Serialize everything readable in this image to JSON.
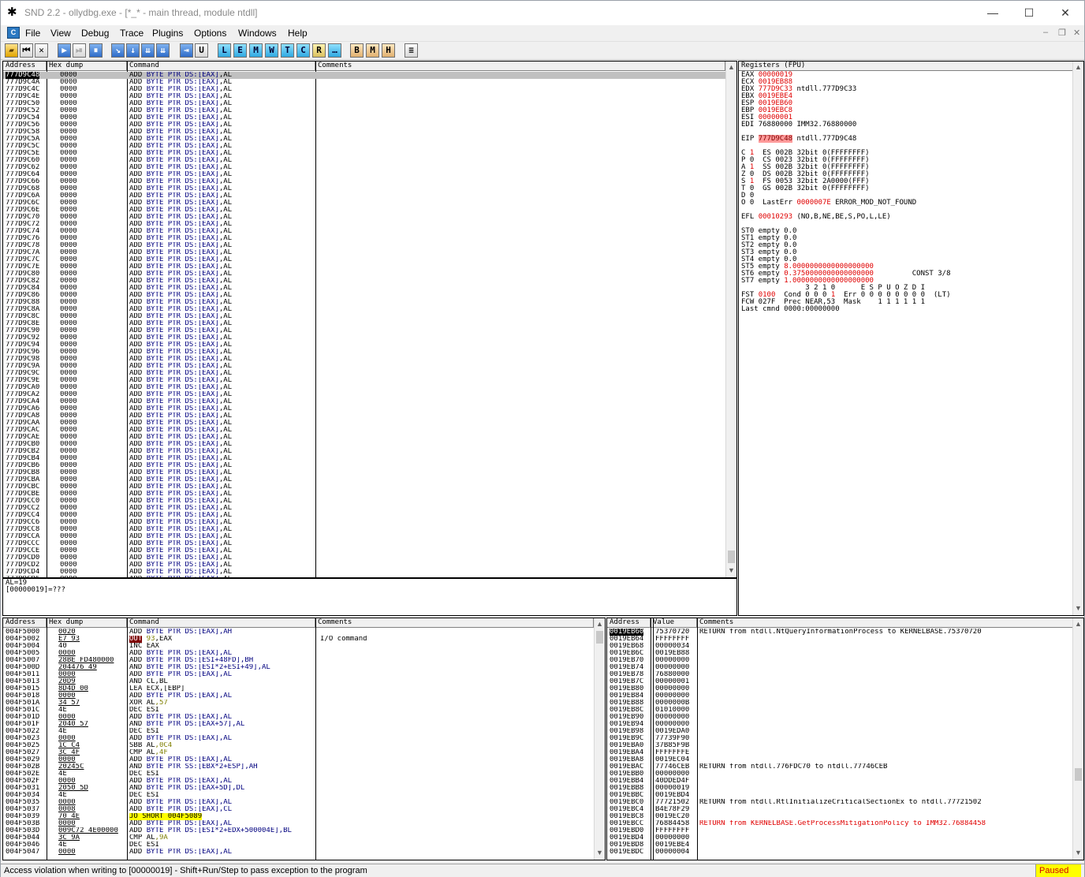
{
  "window": {
    "title": "SND 2.2 - ollydbg.exe - [*_* - main thread, module ntdll]",
    "minimize": "—",
    "maximize": "☐",
    "close": "✕"
  },
  "menu": {
    "mdi_icon": "C",
    "items": [
      "File",
      "View",
      "Debug",
      "Trace",
      "Plugins",
      "Options",
      "Windows",
      "Help"
    ],
    "mdi_min": "‒",
    "mdi_restore": "❐",
    "mdi_close": "✕"
  },
  "toolbar": {
    "buttons": [
      "open",
      "⏮",
      "✕",
      "▶",
      "⏸",
      "⏯",
      "↘",
      "↓",
      "⇊",
      "⇥",
      "U",
      "L",
      "E",
      "M",
      "W",
      "T",
      "C",
      "R",
      "…",
      "B",
      "M",
      "H",
      "≡"
    ]
  },
  "cpu": {
    "headers": {
      "address": "Address",
      "hex": "Hex dump",
      "command": "Command",
      "comments": "Comments"
    },
    "start_addr": "777D9C48",
    "hex": "0000",
    "cmd_parts": [
      "ADD ",
      "BYTE PTR ",
      "DS:[EAX]",
      ",AL"
    ],
    "row_count": 72
  },
  "info": {
    "lines": [
      "AL=19",
      "[00000019]=???"
    ]
  },
  "registers": {
    "title": "Registers (FPU)",
    "lines": [
      [
        [
          "EAX ",
          ""
        ],
        [
          "00000019",
          "red"
        ]
      ],
      [
        [
          "ECX ",
          ""
        ],
        [
          "0019EB88",
          "red"
        ]
      ],
      [
        [
          "EDX ",
          ""
        ],
        [
          "777D9C33",
          "red"
        ],
        [
          " ntdll.777D9C33",
          ""
        ]
      ],
      [
        [
          "EBX ",
          ""
        ],
        [
          "0019EBE4",
          "red"
        ]
      ],
      [
        [
          "ESP ",
          ""
        ],
        [
          "0019EB60",
          "red"
        ]
      ],
      [
        [
          "EBP ",
          ""
        ],
        [
          "0019EBC8",
          "red"
        ]
      ],
      [
        [
          "ESI ",
          ""
        ],
        [
          "00000001",
          "red"
        ]
      ],
      [
        [
          "EDI ",
          ""
        ],
        [
          "76880000",
          ""
        ],
        [
          " IMM32.76880000",
          ""
        ]
      ],
      [
        [
          "",
          ""
        ]
      ],
      [
        [
          "EIP ",
          ""
        ],
        [
          "777D9C48",
          "hl"
        ],
        [
          " ntdll.777D9C48",
          ""
        ]
      ],
      [
        [
          "",
          ""
        ]
      ],
      [
        [
          "C ",
          ""
        ],
        [
          "1",
          "red"
        ],
        [
          "  ES 002B 32bit 0(FFFFFFFF)",
          ""
        ]
      ],
      [
        [
          "P 0  CS 0023 32bit 0(FFFFFFFF)",
          ""
        ]
      ],
      [
        [
          "A ",
          ""
        ],
        [
          "1",
          "red"
        ],
        [
          "  SS 002B 32bit 0(FFFFFFFF)",
          ""
        ]
      ],
      [
        [
          "Z 0  DS 002B 32bit 0(FFFFFFFF)",
          ""
        ]
      ],
      [
        [
          "S ",
          ""
        ],
        [
          "1",
          "red"
        ],
        [
          "  FS 0053 32bit 2A0000(FFF)",
          ""
        ]
      ],
      [
        [
          "T 0  GS 002B 32bit 0(FFFFFFFF)",
          ""
        ]
      ],
      [
        [
          "D 0",
          ""
        ]
      ],
      [
        [
          "O 0  LastErr ",
          ""
        ],
        [
          "0000007E",
          "red"
        ],
        [
          " ERROR_MOD_NOT_FOUND",
          ""
        ]
      ],
      [
        [
          "",
          ""
        ]
      ],
      [
        [
          "EFL ",
          ""
        ],
        [
          "00010293",
          "red"
        ],
        [
          " (NO,B,NE,BE,S,PO,L,LE)",
          ""
        ]
      ],
      [
        [
          "",
          ""
        ]
      ],
      [
        [
          "ST0 empty 0.0",
          ""
        ]
      ],
      [
        [
          "ST1 empty 0.0",
          ""
        ]
      ],
      [
        [
          "ST2 empty 0.0",
          ""
        ]
      ],
      [
        [
          "ST3 empty 0.0",
          ""
        ]
      ],
      [
        [
          "ST4 empty 0.0",
          ""
        ]
      ],
      [
        [
          "ST5 empty ",
          ""
        ],
        [
          "8.0000000000000000000",
          "red"
        ]
      ],
      [
        [
          "ST6 empty ",
          ""
        ],
        [
          "0.3750000000000000000",
          "red"
        ],
        [
          "         CONST 3/8",
          ""
        ]
      ],
      [
        [
          "ST7 empty ",
          ""
        ],
        [
          "1.0000000000000000000",
          "red"
        ]
      ],
      [
        [
          "               3 2 1 0      E S P U O Z D I",
          ""
        ]
      ],
      [
        [
          "FST ",
          ""
        ],
        [
          "0100",
          "red"
        ],
        [
          "  Cond 0 0 0 ",
          ""
        ],
        [
          "1",
          "red"
        ],
        [
          "  Err 0 0 0 0 0 0 0 0  (LT)",
          ""
        ]
      ],
      [
        [
          "FCW 027F  Prec NEAR,53  Mask    1 1 1 1 1 1",
          ""
        ]
      ],
      [
        [
          "Last cmnd 0000:00000000",
          ""
        ]
      ]
    ]
  },
  "dump": {
    "headers": {
      "address": "Address",
      "hex": "Hex dump",
      "command": "Command",
      "comments": "Comments"
    },
    "rows": [
      [
        "004F5000",
        "0020",
        "ADD BYTE PTR DS:[EAX],AH",
        ""
      ],
      [
        "004F5002",
        "E7 93",
        "OUT 93,EAX",
        "I/O command"
      ],
      [
        "004F5004",
        "40",
        "INC EAX",
        ""
      ],
      [
        "004F5005",
        "0000",
        "ADD BYTE PTR DS:[EAX],AL",
        ""
      ],
      [
        "004F5007",
        "28BE FD480000",
        "ADD BYTE PTR DS:[ESI+48FD],BH",
        ""
      ],
      [
        "004F500D",
        "204476 49",
        "AND BYTE PTR DS:[ESI*2+ESI+49],AL",
        ""
      ],
      [
        "004F5011",
        "0000",
        "ADD BYTE PTR DS:[EAX],AL",
        ""
      ],
      [
        "004F5013",
        "20D9",
        "AND CL,BL",
        ""
      ],
      [
        "004F5015",
        "8D4D 00",
        "LEA ECX,[EBP]",
        ""
      ],
      [
        "004F5018",
        "0000",
        "ADD BYTE PTR DS:[EAX],AL",
        ""
      ],
      [
        "004F501A",
        "34 57",
        "XOR AL,57",
        ""
      ],
      [
        "004F501C",
        "4E",
        "DEC ESI",
        ""
      ],
      [
        "004F501D",
        "0000",
        "ADD BYTE PTR DS:[EAX],AL",
        ""
      ],
      [
        "004F501F",
        "2040 57",
        "AND BYTE PTR DS:[EAX+57],AL",
        ""
      ],
      [
        "004F5022",
        "4E",
        "DEC ESI",
        ""
      ],
      [
        "004F5023",
        "0000",
        "ADD BYTE PTR DS:[EAX],AL",
        ""
      ],
      [
        "004F5025",
        "1C C4",
        "SBB AL,0C4",
        ""
      ],
      [
        "004F5027",
        "3C 4F",
        "CMP AL,4F",
        ""
      ],
      [
        "004F5029",
        "0000",
        "ADD BYTE PTR DS:[EAX],AL",
        ""
      ],
      [
        "004F502B",
        "20245C",
        "AND BYTE PTR SS:[EBX*2+ESP],AH",
        ""
      ],
      [
        "004F502E",
        "4E",
        "DEC ESI",
        ""
      ],
      [
        "004F502F",
        "0000",
        "ADD BYTE PTR DS:[EAX],AL",
        ""
      ],
      [
        "004F5031",
        "2050 5D",
        "AND BYTE PTR DS:[EAX+5D],DL",
        ""
      ],
      [
        "004F5034",
        "4E",
        "DEC ESI",
        ""
      ],
      [
        "004F5035",
        "0000",
        "ADD BYTE PTR DS:[EAX],AL",
        ""
      ],
      [
        "004F5037",
        "0008",
        "ADD BYTE PTR DS:[EAX],CL",
        ""
      ],
      [
        "004F5039",
        "70 4E",
        "JO SHORT 004F5089",
        ""
      ],
      [
        "004F503B",
        "0000",
        "ADD BYTE PTR DS:[EAX],AL",
        ""
      ],
      [
        "004F503D",
        "009C72 4E00000",
        "ADD BYTE PTR DS:[ESI*2+EDX+500004E],BL",
        ""
      ],
      [
        "004F5044",
        "3C 9A",
        "CMP AL,9A",
        ""
      ],
      [
        "004F5046",
        "4E",
        "DEC ESI",
        ""
      ],
      [
        "004F5047",
        "0000",
        "ADD BYTE PTR DS:[EAX],AL",
        ""
      ]
    ]
  },
  "stack": {
    "headers": {
      "address": "Address",
      "value": "Value",
      "comments": "Comments"
    },
    "rows": [
      [
        "0019EB60",
        "75370720",
        "RETURN from ntdll.NtQueryInformationProcess to KERNELBASE.75370720",
        ""
      ],
      [
        "0019EB64",
        "FFFFFFFF",
        "",
        ""
      ],
      [
        "0019EB68",
        "00000034",
        "",
        ""
      ],
      [
        "0019EB6C",
        "0019EB88",
        "",
        ""
      ],
      [
        "0019EB70",
        "00000000",
        "",
        ""
      ],
      [
        "0019EB74",
        "00000000",
        "",
        ""
      ],
      [
        "0019EB78",
        "76880000",
        "",
        ""
      ],
      [
        "0019EB7C",
        "00000001",
        "",
        ""
      ],
      [
        "0019EB80",
        "00000000",
        "",
        ""
      ],
      [
        "0019EB84",
        "00000000",
        "",
        ""
      ],
      [
        "0019EB88",
        "0000000B",
        "",
        ""
      ],
      [
        "0019EB8C",
        "01010000",
        "",
        ""
      ],
      [
        "0019EB90",
        "00000000",
        "",
        ""
      ],
      [
        "0019EB94",
        "00000000",
        "",
        ""
      ],
      [
        "0019EB98",
        "0019EDA0",
        "",
        ""
      ],
      [
        "0019EB9C",
        "77739F90",
        "",
        ""
      ],
      [
        "0019EBA0",
        "37B85F9B",
        "",
        ""
      ],
      [
        "0019EBA4",
        "FFFFFFFE",
        "",
        ""
      ],
      [
        "0019EBA8",
        "0019EC04",
        "",
        ""
      ],
      [
        "0019EBAC",
        "77746CEB",
        "RETURN from ntdll.776FDC70 to ntdll.77746CEB",
        ""
      ],
      [
        "0019EBB0",
        "00000000",
        "",
        ""
      ],
      [
        "0019EBB4",
        "40DDED4F",
        "",
        ""
      ],
      [
        "0019EBB8",
        "00000019",
        "",
        ""
      ],
      [
        "0019EBBC",
        "0019EBD4",
        "",
        ""
      ],
      [
        "0019EBC0",
        "77721502",
        "RETURN from ntdll.RtlInitializeCriticalSectionEx to ntdll.77721502",
        ""
      ],
      [
        "0019EBC4",
        "B4E78F29",
        "",
        ""
      ],
      [
        "0019EBC8",
        "0019EC20",
        "",
        ""
      ],
      [
        "0019EBCC",
        "76884458",
        "RETURN from KERNELBASE.GetProcessMitigationPolicy to IMM32.76884458",
        "red"
      ],
      [
        "0019EBD0",
        "FFFFFFFF",
        "",
        ""
      ],
      [
        "0019EBD4",
        "00000000",
        "",
        ""
      ],
      [
        "0019EBD8",
        "0019EBE4",
        "",
        ""
      ],
      [
        "0019EBDC",
        "00000004",
        "",
        ""
      ]
    ]
  },
  "status": {
    "message": "Access violation when writing to [00000019] - Shift+Run/Step to pass exception to the program",
    "state": "Paused"
  }
}
